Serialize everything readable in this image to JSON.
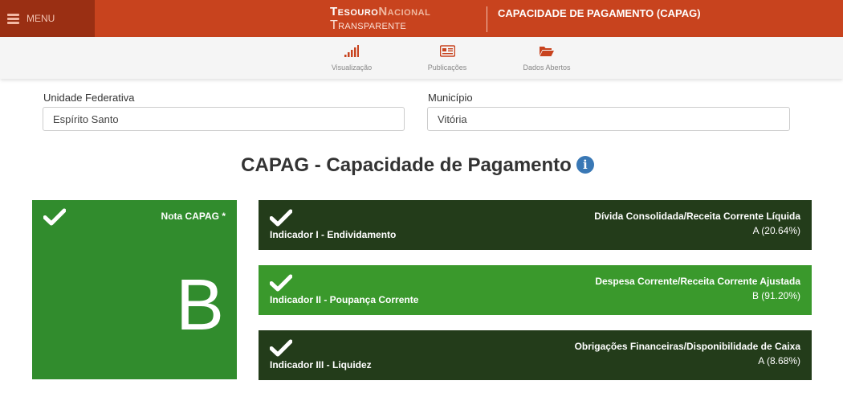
{
  "header": {
    "menu_label": "MENU",
    "logo_line1_a": "Tesouro",
    "logo_line1_b": "Nacional",
    "logo_line2": "Transparente",
    "page_title": "CAPACIDADE DE PAGAMENTO (CAPAG)",
    "color": "#c8431e"
  },
  "nav": {
    "items": [
      {
        "label": "Visualização",
        "icon": "bar-chart-icon"
      },
      {
        "label": "Publicações",
        "icon": "newspaper-icon"
      },
      {
        "label": "Dados Abertos",
        "icon": "folder-open-icon"
      }
    ]
  },
  "filters": {
    "uf_label": "Unidade Federativa",
    "uf_value": "Espírito Santo",
    "municipio_label": "Município",
    "municipio_value": "Vitória"
  },
  "title": "CAPAG - Capacidade de Pagamento",
  "info_icon": "i",
  "capag": {
    "label": "Nota CAPAG *",
    "grade": "B",
    "color": "#318c2d"
  },
  "indicators": [
    {
      "name": "Indicador I - Endividamento",
      "metric": "Dívida Consolidada/Receita Corrente Líquida",
      "value": "A (20.64%)",
      "color": "#233c1a"
    },
    {
      "name": "Indicador II - Poupança Corrente",
      "metric": "Despesa Corrente/Receita Corrente Ajustada",
      "value": "B (91.20%)",
      "color": "#3a992c"
    },
    {
      "name": "Indicador III - Liquidez",
      "metric": "Obrigações Financeiras/Disponibilidade de Caixa",
      "value": "A (8.68%)",
      "color": "#233c1a"
    }
  ]
}
